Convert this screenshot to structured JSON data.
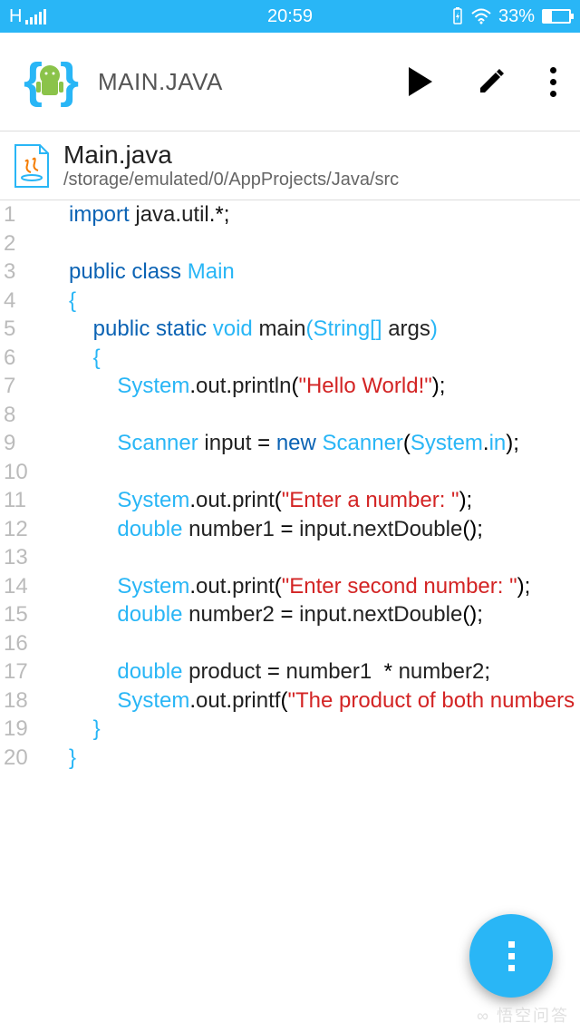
{
  "status": {
    "network": "H",
    "time": "20:59",
    "battery_pct": "33%"
  },
  "appbar": {
    "title": "MAIN.JAVA"
  },
  "file": {
    "name": "Main.java",
    "path": "/storage/emulated/0/AppProjects/Java/src"
  },
  "code": {
    "lines": [
      [
        {
          "t": "import ",
          "c": "kw"
        },
        {
          "t": "java",
          "c": "id"
        },
        {
          "t": ".",
          "c": "punc"
        },
        {
          "t": "util",
          "c": "id"
        },
        {
          "t": ".*;",
          "c": "punc"
        }
      ],
      [],
      [
        {
          "t": "public class ",
          "c": "kw"
        },
        {
          "t": "Main",
          "c": "ty"
        }
      ],
      [
        {
          "t": "{",
          "c": "ty"
        }
      ],
      [
        {
          "t": "    ",
          "c": "id"
        },
        {
          "t": "public static ",
          "c": "kw"
        },
        {
          "t": "void ",
          "c": "ty"
        },
        {
          "t": "main",
          "c": "id"
        },
        {
          "t": "(",
          "c": "ty"
        },
        {
          "t": "String",
          "c": "ty"
        },
        {
          "t": "[] ",
          "c": "ty"
        },
        {
          "t": "args",
          "c": "id"
        },
        {
          "t": ")",
          "c": "ty"
        }
      ],
      [
        {
          "t": "    ",
          "c": "id"
        },
        {
          "t": "{",
          "c": "ty"
        }
      ],
      [
        {
          "t": "        ",
          "c": "id"
        },
        {
          "t": "System",
          "c": "ty"
        },
        {
          "t": ".",
          "c": "punc"
        },
        {
          "t": "out",
          "c": "id"
        },
        {
          "t": ".",
          "c": "punc"
        },
        {
          "t": "println",
          "c": "id"
        },
        {
          "t": "(",
          "c": "punc"
        },
        {
          "t": "\"Hello World!\"",
          "c": "str"
        },
        {
          "t": ");",
          "c": "punc"
        }
      ],
      [],
      [
        {
          "t": "        ",
          "c": "id"
        },
        {
          "t": "Scanner ",
          "c": "ty"
        },
        {
          "t": "input ",
          "c": "id"
        },
        {
          "t": "= ",
          "c": "punc"
        },
        {
          "t": "new ",
          "c": "kw"
        },
        {
          "t": "Scanner",
          "c": "ty"
        },
        {
          "t": "(",
          "c": "punc"
        },
        {
          "t": "System",
          "c": "ty"
        },
        {
          "t": ".",
          "c": "punc"
        },
        {
          "t": "in",
          "c": "ty"
        },
        {
          "t": ");",
          "c": "punc"
        }
      ],
      [],
      [
        {
          "t": "        ",
          "c": "id"
        },
        {
          "t": "System",
          "c": "ty"
        },
        {
          "t": ".",
          "c": "punc"
        },
        {
          "t": "out",
          "c": "id"
        },
        {
          "t": ".",
          "c": "punc"
        },
        {
          "t": "print",
          "c": "id"
        },
        {
          "t": "(",
          "c": "punc"
        },
        {
          "t": "\"Enter a number: \"",
          "c": "str"
        },
        {
          "t": ");",
          "c": "punc"
        }
      ],
      [
        {
          "t": "        ",
          "c": "id"
        },
        {
          "t": "double ",
          "c": "ty"
        },
        {
          "t": "number1 ",
          "c": "id"
        },
        {
          "t": "= ",
          "c": "punc"
        },
        {
          "t": "input",
          "c": "id"
        },
        {
          "t": ".",
          "c": "punc"
        },
        {
          "t": "nextDouble",
          "c": "id"
        },
        {
          "t": "();",
          "c": "punc"
        }
      ],
      [],
      [
        {
          "t": "        ",
          "c": "id"
        },
        {
          "t": "System",
          "c": "ty"
        },
        {
          "t": ".",
          "c": "punc"
        },
        {
          "t": "out",
          "c": "id"
        },
        {
          "t": ".",
          "c": "punc"
        },
        {
          "t": "print",
          "c": "id"
        },
        {
          "t": "(",
          "c": "punc"
        },
        {
          "t": "\"Enter second number: \"",
          "c": "str"
        },
        {
          "t": ");",
          "c": "punc"
        }
      ],
      [
        {
          "t": "        ",
          "c": "id"
        },
        {
          "t": "double ",
          "c": "ty"
        },
        {
          "t": "number2 ",
          "c": "id"
        },
        {
          "t": "= ",
          "c": "punc"
        },
        {
          "t": "input",
          "c": "id"
        },
        {
          "t": ".",
          "c": "punc"
        },
        {
          "t": "nextDouble",
          "c": "id"
        },
        {
          "t": "();",
          "c": "punc"
        }
      ],
      [],
      [
        {
          "t": "        ",
          "c": "id"
        },
        {
          "t": "double ",
          "c": "ty"
        },
        {
          "t": "product ",
          "c": "id"
        },
        {
          "t": "= ",
          "c": "punc"
        },
        {
          "t": "number1  ",
          "c": "id"
        },
        {
          "t": "* ",
          "c": "punc"
        },
        {
          "t": "number2",
          "c": "id"
        },
        {
          "t": ";",
          "c": "punc"
        }
      ],
      [
        {
          "t": "        ",
          "c": "id"
        },
        {
          "t": "System",
          "c": "ty"
        },
        {
          "t": ".",
          "c": "punc"
        },
        {
          "t": "out",
          "c": "id"
        },
        {
          "t": ".",
          "c": "punc"
        },
        {
          "t": "printf",
          "c": "id"
        },
        {
          "t": "(",
          "c": "punc"
        },
        {
          "t": "\"The product of both numbers",
          "c": "str"
        }
      ],
      [
        {
          "t": "    ",
          "c": "id"
        },
        {
          "t": "}",
          "c": "ty"
        }
      ],
      [
        {
          "t": "}",
          "c": "ty"
        }
      ]
    ]
  },
  "watermark": "∞ 悟空问答"
}
